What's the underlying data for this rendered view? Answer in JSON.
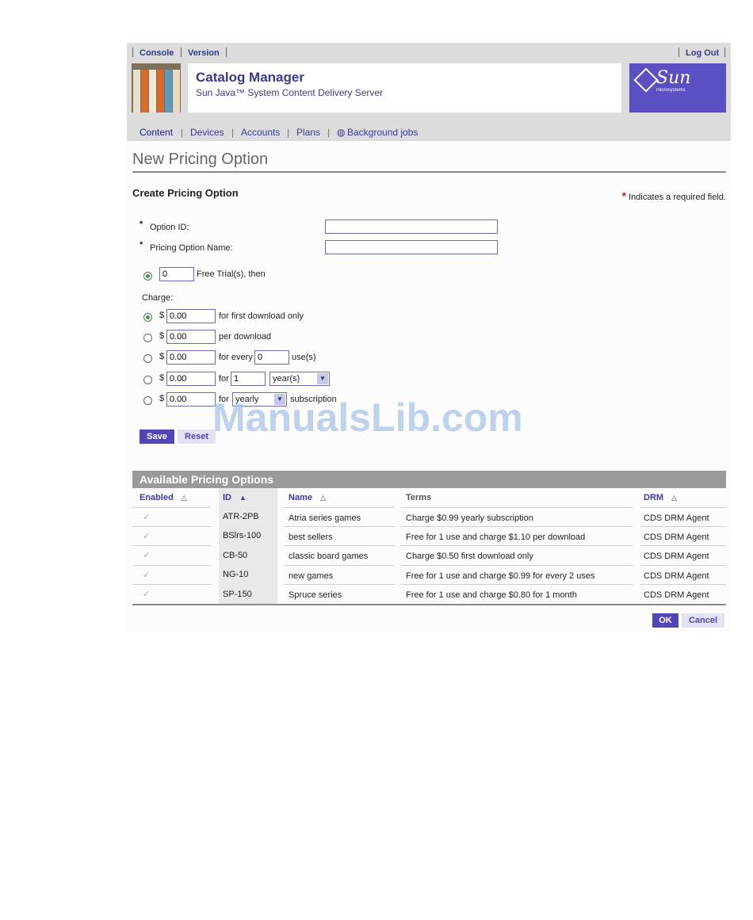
{
  "masthead": {
    "links": [
      "Console",
      "Version"
    ],
    "logout": "Log Out",
    "app_title": "Catalog Manager",
    "app_subtitle": "Sun Java™ System Content Delivery Server",
    "logo_word": "Sun",
    "logo_micro": "microsystems"
  },
  "nav": {
    "tabs": [
      "Content",
      "Devices",
      "Accounts",
      "Plans",
      "Background jobs"
    ],
    "active": "Content"
  },
  "page": {
    "title": "New Pricing Option",
    "section_title": "Create Pricing Option",
    "required_note": "Indicates a required field.",
    "required_star": "*"
  },
  "form": {
    "option_id_label": "Option ID:",
    "option_id_value": "",
    "pricing_name_label": "Pricing Option Name:",
    "pricing_name_value": "",
    "free_trials_value": "0",
    "free_trials_label": "Free Trial(s), then",
    "charge_label": "Charge:",
    "currency": "$",
    "options": [
      {
        "amount": "0.00",
        "text": "for first download only",
        "selected": true
      },
      {
        "amount": "0.00",
        "text": "per download",
        "selected": false
      },
      {
        "amount": "0.00",
        "text": "for every",
        "count": "0",
        "suffix": "use(s)",
        "selected": false
      },
      {
        "amount": "0.00",
        "text": "for",
        "count": "1",
        "unit": "year(s)",
        "selected": false
      },
      {
        "amount": "0.00",
        "text": "for",
        "period": "yearly",
        "suffix": "subscription",
        "selected": false
      }
    ],
    "save_label": "Save",
    "reset_label": "Reset"
  },
  "table": {
    "title": "Available Pricing Options",
    "headers": [
      "Enabled",
      "ID",
      "Name",
      "Terms",
      "DRM"
    ],
    "rows": [
      {
        "enabled": true,
        "id": "ATR-2PB",
        "name": "Atria series games",
        "terms": "Charge $0.99 yearly subscription",
        "drm": "CDS DRM Agent"
      },
      {
        "enabled": true,
        "id": "BSlrs-100",
        "name": "best sellers",
        "terms": "Free for 1 use and charge $1.10 per download",
        "drm": "CDS DRM Agent"
      },
      {
        "enabled": true,
        "id": "CB-50",
        "name": "classic board games",
        "terms": "Charge $0.50 first download only",
        "drm": "CDS DRM Agent"
      },
      {
        "enabled": true,
        "id": "NG-10",
        "name": "new games",
        "terms": "Free for 1 use and charge $0.99 for every 2 uses",
        "drm": "CDS DRM Agent"
      },
      {
        "enabled": true,
        "id": "SP-150",
        "name": "Spruce series",
        "terms": "Free for 1 use and charge $0.80 for 1 month",
        "drm": "CDS DRM Agent"
      }
    ],
    "ok_label": "OK",
    "cancel_label": "Cancel"
  },
  "watermark": "ManualsLib.com",
  "colors": {
    "accent": "#5046b8",
    "link": "#3a3aa0",
    "required": "#c0272d",
    "logo_bg": "#5b4fc4"
  }
}
